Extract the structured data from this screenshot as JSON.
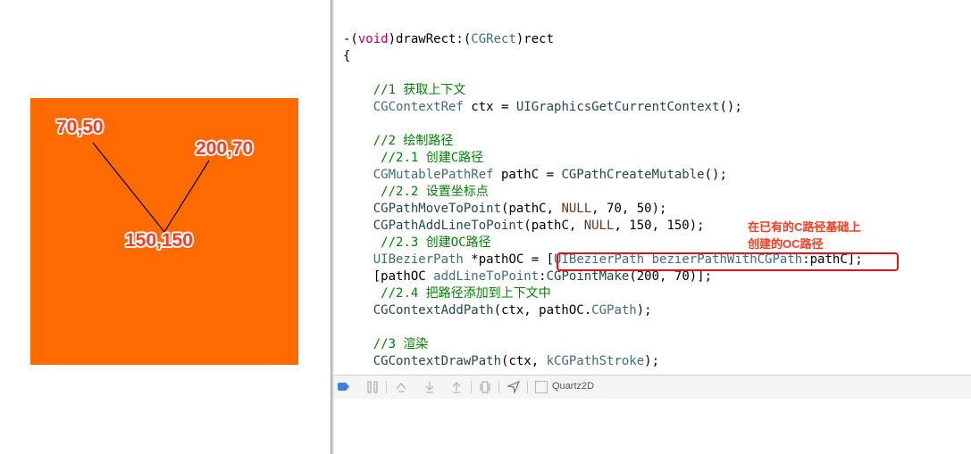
{
  "simulator": {
    "canvas_color": "#ff6b00",
    "line_color": "#000000",
    "labels": {
      "start": "70,50",
      "mid": "150,150",
      "end": "200,70"
    }
  },
  "editor": {
    "lines": [
      [
        [
          "pl",
          "-("
        ],
        [
          "kw",
          "void"
        ],
        [
          "pl",
          ")drawRect:("
        ],
        [
          "ty",
          "CGRect"
        ],
        [
          "pl",
          ")rect"
        ]
      ],
      [
        [
          "pl",
          "{"
        ]
      ],
      [],
      [
        [
          "pl",
          "    "
        ],
        [
          "cm",
          "//1 获取上下文"
        ]
      ],
      [
        [
          "pl",
          "    "
        ],
        [
          "ty",
          "CGContextRef"
        ],
        [
          "pl",
          " ctx = "
        ],
        [
          "fn",
          "UIGraphicsGetCurrentContext"
        ],
        [
          "pl",
          "();"
        ]
      ],
      [],
      [
        [
          "pl",
          "    "
        ],
        [
          "cm",
          "//2 绘制路径"
        ]
      ],
      [
        [
          "pl",
          "     "
        ],
        [
          "cm",
          "//2.1 创建C路径"
        ]
      ],
      [
        [
          "pl",
          "    "
        ],
        [
          "ty",
          "CGMutablePathRef"
        ],
        [
          "pl",
          " pathC = "
        ],
        [
          "fn",
          "CGPathCreateMutable"
        ],
        [
          "pl",
          "();"
        ]
      ],
      [
        [
          "pl",
          "     "
        ],
        [
          "cm",
          "//2.2 设置坐标点"
        ]
      ],
      [
        [
          "pl",
          "    "
        ],
        [
          "fn",
          "CGPathMoveToPoint"
        ],
        [
          "pl",
          "(pathC, "
        ],
        [
          "mc",
          "NULL"
        ],
        [
          "pl",
          ", 70, 50);"
        ]
      ],
      [
        [
          "pl",
          "    "
        ],
        [
          "fn",
          "CGPathAddLineToPoint"
        ],
        [
          "pl",
          "(pathC, "
        ],
        [
          "mc",
          "NULL"
        ],
        [
          "pl",
          ", 150, 150);"
        ]
      ],
      [
        [
          "pl",
          "     "
        ],
        [
          "cm",
          "//2.3 创建OC路径"
        ]
      ],
      [
        [
          "pl",
          "    "
        ],
        [
          "ty",
          "UIBezierPath"
        ],
        [
          "pl",
          " *pathOC = ["
        ],
        [
          "ty",
          "UIBezierPath"
        ],
        [
          "pl",
          " "
        ],
        [
          "ac",
          "bezierPathWithCGPath"
        ],
        [
          "pl",
          ":pathC];"
        ]
      ],
      [
        [
          "pl",
          "    [pathOC "
        ],
        [
          "ac",
          "addLineToPoint"
        ],
        [
          "pl",
          ":"
        ],
        [
          "fn",
          "CGPointMake"
        ],
        [
          "pl",
          "(200, 70)];"
        ]
      ],
      [
        [
          "pl",
          "     "
        ],
        [
          "cm",
          "//2.4 把路径添加到上下文中"
        ]
      ],
      [
        [
          "pl",
          "    "
        ],
        [
          "fn",
          "CGContextAddPath"
        ],
        [
          "pl",
          "(ctx, pathOC."
        ],
        [
          "ac",
          "CGPath"
        ],
        [
          "pl",
          ");"
        ]
      ],
      [],
      [
        [
          "pl",
          "    "
        ],
        [
          "cm",
          "//3 渲染"
        ]
      ],
      [
        [
          "pl",
          "    "
        ],
        [
          "fn",
          "CGContextDrawPath"
        ],
        [
          "pl",
          "(ctx, "
        ],
        [
          "ac",
          "kCGPathStroke"
        ],
        [
          "pl",
          ");"
        ]
      ]
    ],
    "callout": {
      "line1": "在已有的C路径基础上",
      "line2": "创建的OC路径",
      "color": "#ff3b1f"
    }
  },
  "debug_bar": {
    "process_name": "Quartz2D",
    "icons": [
      "breakpoints-toggle-icon",
      "pause-icon",
      "step-over-icon",
      "step-into-icon",
      "step-out-icon",
      "view-debugger-icon",
      "location-icon",
      "process-icon"
    ]
  }
}
